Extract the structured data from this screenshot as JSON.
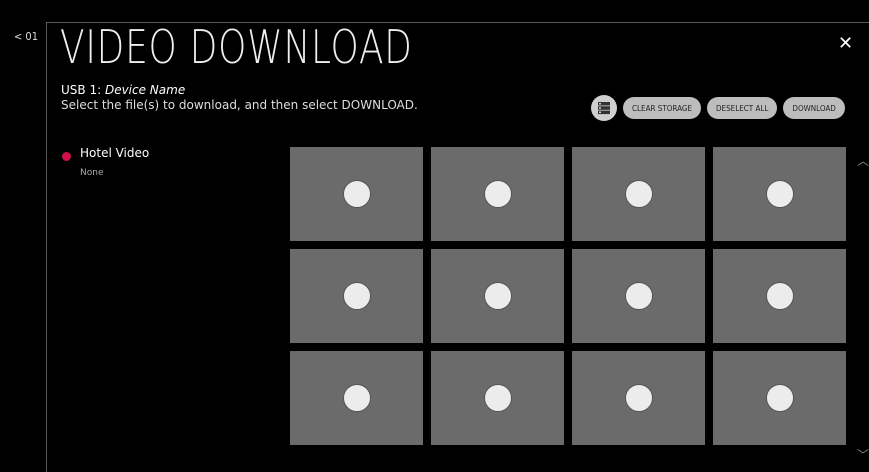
{
  "nav": {
    "back_label": "< 01"
  },
  "header": {
    "title": "VIDEO DOWNLOAD",
    "device_prefix": "USB 1: ",
    "device_name": "Device Name",
    "instruction": "Select the file(s) to download, and then select DOWNLOAD."
  },
  "toolbar": {
    "storage_icon": "storage-icon",
    "clear_storage": "CLEAR STORAGE",
    "deselect_all": "DESELECT ALL",
    "download": "DOWNLOAD"
  },
  "folder": {
    "name": "Hotel Video",
    "sub": "None",
    "dot_color": "#d1104a"
  },
  "grid": {
    "rows": 3,
    "columns": 4,
    "thumb_color": "#6b6b6b",
    "selected": []
  },
  "scroll": {
    "up_icon": "chevron-up-icon",
    "down_icon": "chevron-down-icon"
  },
  "close_icon": "close-icon"
}
